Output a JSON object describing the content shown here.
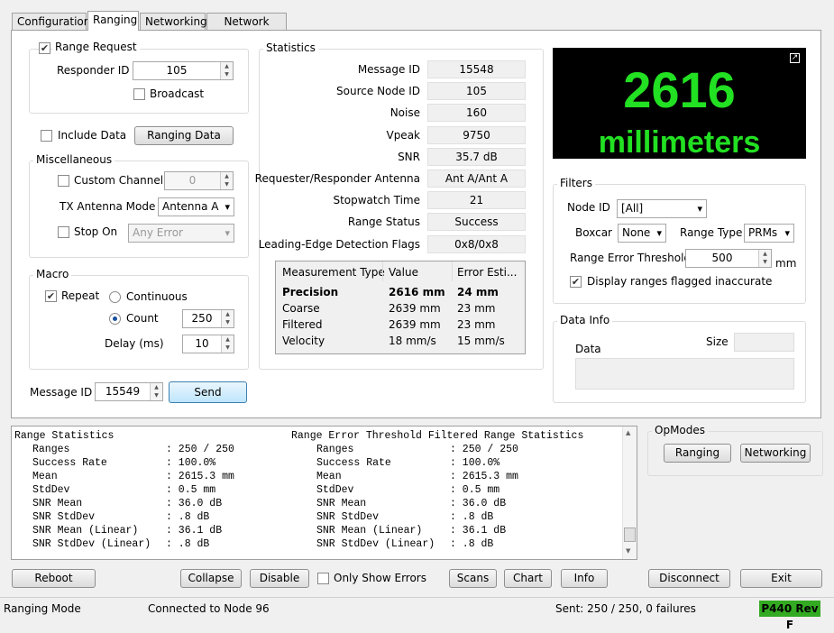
{
  "tabs": [
    "Configuration",
    "Ranging",
    "Networking",
    "Network Stats"
  ],
  "range_request": {
    "label": "Range Request",
    "checked": true,
    "responder_id_label": "Responder ID",
    "responder_id": "105",
    "broadcast_label": "Broadcast"
  },
  "include_data": {
    "label": "Include Data",
    "button": "Ranging Data"
  },
  "misc": {
    "title": "Miscellaneous",
    "custom_channel_label": "Custom Channel",
    "custom_channel": "0",
    "tx_antenna_label": "TX Antenna Mode",
    "tx_antenna": "Antenna A",
    "stop_on_label": "Stop On",
    "stop_on": "Any Error"
  },
  "macro": {
    "title": "Macro",
    "repeat_label": "Repeat",
    "continuous_label": "Continuous",
    "count_label": "Count",
    "count": "250",
    "delay_label": "Delay (ms)",
    "delay": "10"
  },
  "send": {
    "message_id_label": "Message ID",
    "message_id": "15549",
    "button": "Send"
  },
  "statistics": {
    "title": "Statistics",
    "rows": [
      {
        "label": "Message ID",
        "value": "15548"
      },
      {
        "label": "Source Node ID",
        "value": "105"
      },
      {
        "label": "Noise",
        "value": "160"
      },
      {
        "label": "Vpeak",
        "value": "9750"
      },
      {
        "label": "SNR",
        "value": "35.7 dB"
      },
      {
        "label": "Requester/Responder Antenna",
        "value": "Ant A/Ant A"
      },
      {
        "label": "Stopwatch Time",
        "value": "21"
      },
      {
        "label": "Range Status",
        "value": "Success"
      },
      {
        "label": "Leading-Edge Detection Flags",
        "value": "0x8/0x8"
      }
    ],
    "table": {
      "headers": [
        "Measurement Type",
        "Value",
        "Error Esti..."
      ],
      "rows": [
        [
          "Precision",
          "2616 mm",
          "24 mm"
        ],
        [
          "Coarse",
          "2639 mm",
          "23 mm"
        ],
        [
          "Filtered",
          "2639 mm",
          "23 mm"
        ],
        [
          "Velocity",
          "18 mm/s",
          "15 mm/s"
        ]
      ]
    }
  },
  "display": {
    "value": "2616",
    "unit": "millimeters",
    "color": "#22e022",
    "icon": "expand-icon"
  },
  "filters": {
    "title": "Filters",
    "node_id_label": "Node ID",
    "node_id": "[All]",
    "boxcar_label": "Boxcar",
    "boxcar": "None",
    "range_type_label": "Range Type",
    "range_type": "PRMs",
    "threshold_label": "Range Error Threshold",
    "threshold": "500",
    "threshold_unit": "mm",
    "display_inaccurate_label": "Display ranges flagged inaccurate"
  },
  "data_info": {
    "title": "Data Info",
    "data_label": "Data",
    "size_label": "Size"
  },
  "log": {
    "title_left": "Range Statistics",
    "title_right": "Range Error Threshold Filtered Range Statistics",
    "rows": [
      [
        "Ranges",
        ": 250 / 250"
      ],
      [
        "Success Rate",
        ": 100.0%"
      ],
      [
        "Mean",
        ": 2615.3 mm"
      ],
      [
        "StdDev",
        ": 0.5 mm"
      ],
      [
        "SNR Mean",
        ": 36.0 dB"
      ],
      [
        "SNR StdDev",
        ": .8 dB"
      ],
      [
        "SNR Mean (Linear)",
        ": 36.1 dB"
      ],
      [
        "SNR StdDev (Linear)",
        ": .8 dB"
      ]
    ]
  },
  "opmodes": {
    "title": "OpModes",
    "buttons": [
      "Ranging",
      "Networking"
    ]
  },
  "bottom": {
    "reboot": "Reboot",
    "collapse": "Collapse",
    "disable": "Disable",
    "only_errors": "Only Show Errors",
    "scans": "Scans",
    "chart": "Chart",
    "info": "Info",
    "disconnect": "Disconnect",
    "exit": "Exit"
  },
  "status": {
    "mode": "Ranging Mode",
    "connection": "Connected to Node 96",
    "sent": "Sent: 250 / 250, 0 failures",
    "badge": "P440 Rev F",
    "badge_color": "#33aa22"
  }
}
